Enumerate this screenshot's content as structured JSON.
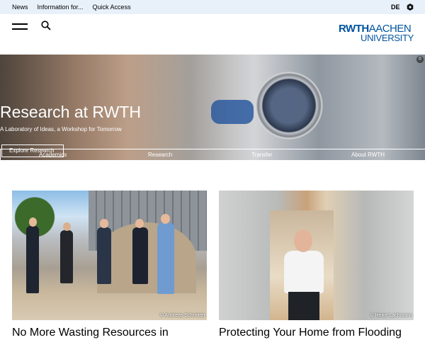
{
  "topbar": {
    "links": [
      "News",
      "Information for...",
      "Quick Access"
    ],
    "lang": "DE",
    "seal_icon": "seal-icon"
  },
  "header": {
    "menu_icon": "hamburger-icon",
    "search_icon": "search-icon",
    "logo_line1_bold": "RWTH",
    "logo_line1_thin": "AACHEN",
    "logo_line2": "UNIVERSITY",
    "brand_color": "#00549f"
  },
  "hero": {
    "title": "Research at RWTH",
    "subtitle": "A Laboratory of Ideas, a Workshop for Tomorrow",
    "button": "Explore Research",
    "copyright": "©"
  },
  "nav": [
    "Academics",
    "Research",
    "Transfer",
    "About RWTH"
  ],
  "cards": [
    {
      "credit": "© Andreas Schmitter",
      "title": "No More Wasting Resources in"
    },
    {
      "credit": "© Heike Lachmann",
      "title": "Protecting Your Home from Flooding"
    }
  ]
}
